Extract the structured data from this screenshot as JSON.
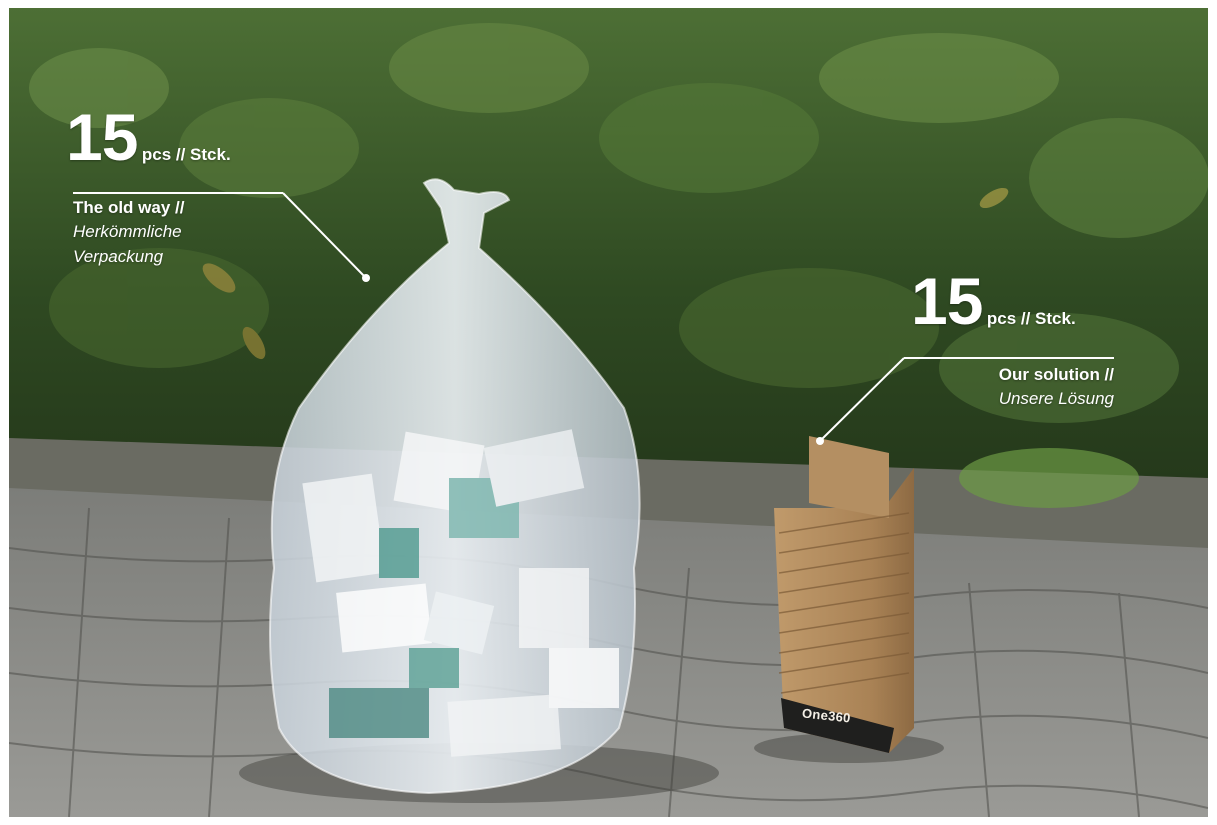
{
  "left_callout": {
    "count": "15",
    "unit": "pcs // Stck.",
    "title": "The old way //",
    "subtitle_line1": "Herkömmliche",
    "subtitle_line2": "Verpackung"
  },
  "right_callout": {
    "count": "15",
    "unit": "pcs // Stck.",
    "title": "Our solution //",
    "subtitle": "Unsere Lösung"
  },
  "box_brand": "One360",
  "colors": {
    "text": "#ffffff",
    "foliage": "#3f5a2c",
    "pavement": "#8c8c88",
    "cardboard": "#b48d5f",
    "plastic_bag": "#dfe7ee"
  }
}
